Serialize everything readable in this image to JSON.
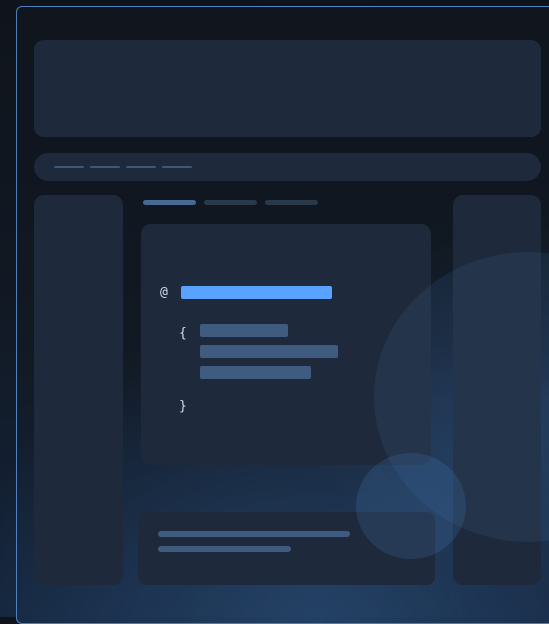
{
  "code_card": {
    "at_symbol": "@",
    "open_brace": "{",
    "close_brace": "}"
  }
}
